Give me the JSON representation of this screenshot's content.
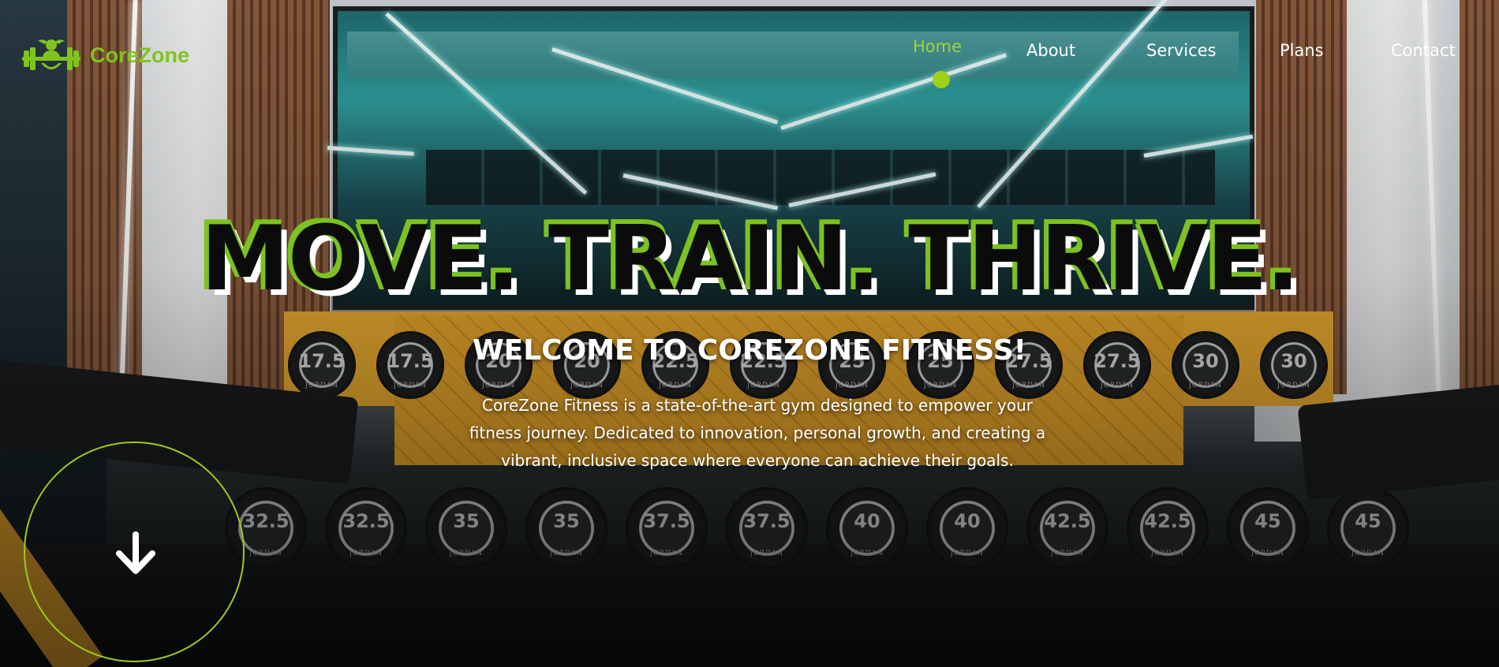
{
  "brand": {
    "name": "CoreZone",
    "color": "#7fc41c",
    "logo_icon": "dumbbell-figure-icon"
  },
  "nav": {
    "items": [
      {
        "label": "Home",
        "active": true
      },
      {
        "label": "About",
        "active": false
      },
      {
        "label": "Services",
        "active": false
      },
      {
        "label": "Plans",
        "active": false
      },
      {
        "label": "Contact",
        "active": false
      }
    ],
    "active_color": "#9fd33a"
  },
  "hero": {
    "headline": "MOVE. TRAIN. THRIVE.",
    "subheading": "WELCOME TO COREZONE FITNESS!",
    "description": "CoreZone Fitness is a state-of-the-art gym designed to empower your fitness journey. Dedicated to innovation, personal growth, and creating a vibrant, inclusive space where everyone can achieve their goals.",
    "scroll_icon": "arrow-down-icon",
    "accent_color": "#9ccb1a"
  },
  "background": {
    "dumbbells_row1": [
      "17.5",
      "17.5",
      "20",
      "20",
      "22.5",
      "22.5",
      "25",
      "25",
      "27.5",
      "27.5",
      "30",
      "30"
    ],
    "dumbbells_row2": [
      "32.5",
      "32.5",
      "35",
      "35",
      "37.5",
      "37.5",
      "40",
      "40",
      "42.5",
      "42.5",
      "45",
      "45"
    ],
    "dumbbell_brand": "JORDAN"
  }
}
